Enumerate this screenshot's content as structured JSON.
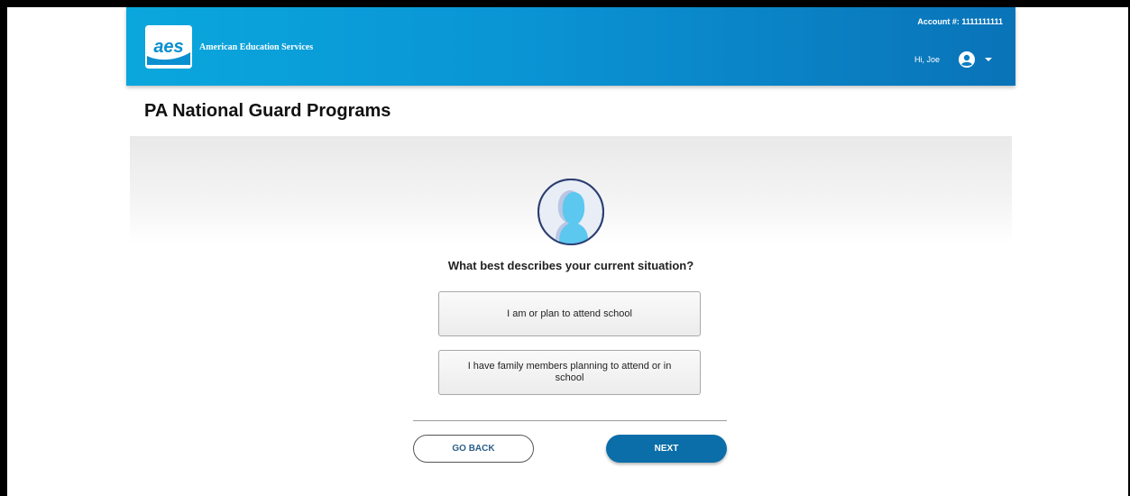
{
  "header": {
    "brand_name": "American Education Services",
    "logo_text": "aes",
    "account_label": "Account #: 1111111111",
    "greeting": "Hi, Joe",
    "user_icon": "user-circle-icon",
    "menu_icon": "caret-down-icon",
    "colors": {
      "gradient_start": "#0aa7dd",
      "gradient_end": "#0a73b8"
    }
  },
  "page": {
    "title": "PA National Guard Programs"
  },
  "main": {
    "avatar_icon": "person-silhouette-icon",
    "question": "What best describes your current situation?",
    "options": [
      {
        "label": "I am or plan to attend school"
      },
      {
        "label": "I have family members planning to attend or in school"
      }
    ]
  },
  "actions": {
    "back_label": "GO BACK",
    "next_label": "NEXT",
    "colors": {
      "next_bg": "#0b6ea9",
      "back_text": "#2b5f8a"
    }
  }
}
